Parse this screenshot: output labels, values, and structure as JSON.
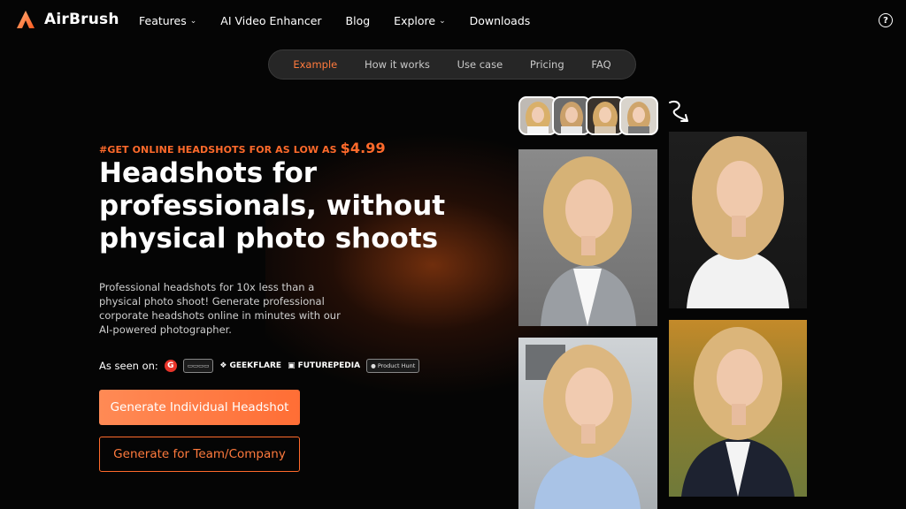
{
  "header": {
    "logo_text": "AirBrush",
    "nav": [
      {
        "label": "Features",
        "has_dropdown": true
      },
      {
        "label": "AI Video Enhancer",
        "has_dropdown": false
      },
      {
        "label": "Blog",
        "has_dropdown": false
      },
      {
        "label": "Explore",
        "has_dropdown": true
      },
      {
        "label": "Downloads",
        "has_dropdown": false
      }
    ],
    "help_icon": "?"
  },
  "subnav": {
    "items": [
      "Example",
      "How it works",
      "Use case",
      "Pricing",
      "FAQ"
    ],
    "active": "Example"
  },
  "hero": {
    "promo_prefix": "#GET ONLINE HEADSHOTS FOR AS LOW AS",
    "promo_price": "$4.99",
    "headline": "Headshots for professionals, without physical photo shoots",
    "description": "Professional headshots for 10x less than a physical photo shoot! Generate professional corporate headshots online in minutes with our AI-powered photographer.",
    "as_seen_on": "As seen on:",
    "press": [
      "G",
      "GEEKFLARE",
      "FUTUREPEDIA",
      "Product Hunt"
    ],
    "primary_button": "Generate Individual Headshot",
    "secondary_button": "Generate for Team/Company"
  },
  "colors": {
    "accent": "#ff6a2b",
    "background": "#050505",
    "pill_bg": "#262626"
  }
}
